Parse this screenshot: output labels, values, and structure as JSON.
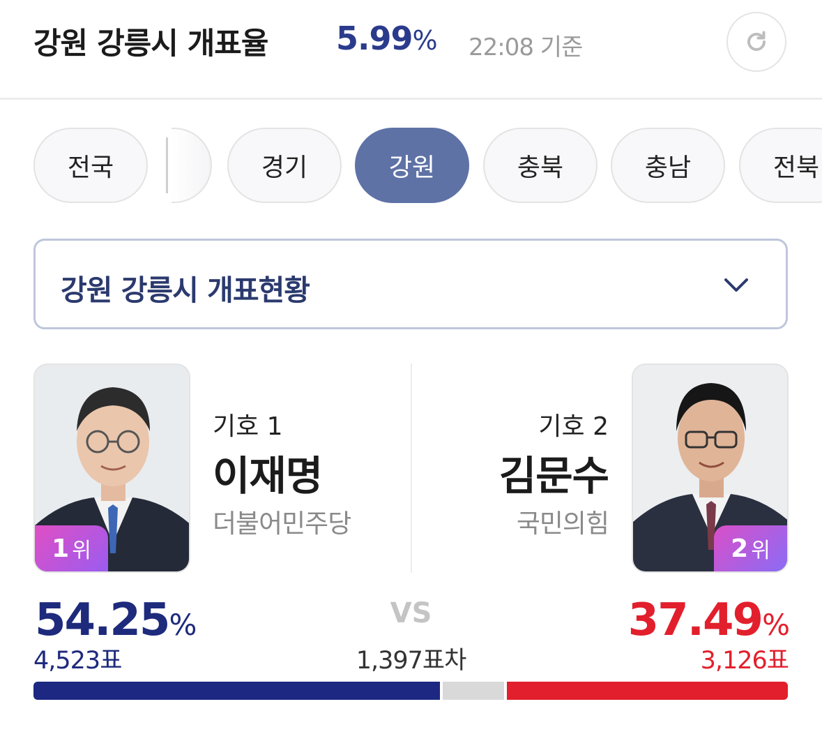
{
  "header": {
    "title": "강원 강릉시 개표율",
    "rate_value": "5.99",
    "rate_unit": "%",
    "time": "22:08 기준"
  },
  "tabs": [
    {
      "label": "전국",
      "active": false
    },
    {
      "label": "경기",
      "active": false
    },
    {
      "label": "강원",
      "active": true
    },
    {
      "label": "충북",
      "active": false
    },
    {
      "label": "충남",
      "active": false
    },
    {
      "label": "전북",
      "active": false
    }
  ],
  "region_select": {
    "label": "강원 강릉시 개표현황"
  },
  "candidates": {
    "left": {
      "number": "기호 1",
      "name": "이재명",
      "party": "더불어민주당",
      "rank_num": "1",
      "rank_unit": "위",
      "percent": "54.25",
      "percent_unit": "%",
      "votes": "4,523표",
      "color": "#1e2a7c"
    },
    "right": {
      "number": "기호 2",
      "name": "김문수",
      "party": "국민의힘",
      "rank_num": "2",
      "rank_unit": "위",
      "percent": "37.49",
      "percent_unit": "%",
      "votes": "3,126표",
      "color": "#e21f2c"
    }
  },
  "comparison": {
    "vs": "VS",
    "gap": "1,397표차"
  },
  "vote_bar": {
    "left_share": 54.25,
    "right_share": 37.49,
    "left_color": "#1c2882",
    "remaining_color": "#d9d9d9",
    "right_color": "#e21f2c"
  }
}
